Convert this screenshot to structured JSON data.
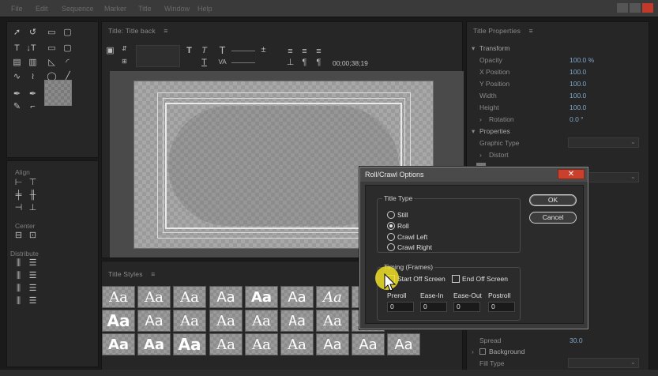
{
  "app": {
    "menu_items": [
      "File",
      "Edit",
      "Sequence",
      "Marker",
      "Title",
      "Window",
      "Help"
    ]
  },
  "tools_panel": {
    "tools": [
      "selection",
      "rotation",
      "text",
      "vertical-text",
      "area-text",
      "vertical-area-text",
      "path-text",
      "vertical-path-text",
      "pen",
      "delete-anchor",
      "add-anchor",
      "convert-anchor",
      "rectangle",
      "clipped-corner-rectangle",
      "rounded-corner-rectangle",
      "rounded-rectangle",
      "wedge",
      "arc",
      "ellipse",
      "line"
    ]
  },
  "actions_panel": {
    "align_label": "Align",
    "center_label": "Center",
    "distribute_label": "Distribute"
  },
  "title_panel": {
    "header": "Title: Title back",
    "timecode": "00;00;38;19"
  },
  "styles_panel": {
    "header": "Title Styles",
    "cell_text": "Aa"
  },
  "properties_panel": {
    "header": "Title Properties",
    "transform_label": "Transform",
    "rows": [
      {
        "key": "Opacity",
        "value": "100.0 %"
      },
      {
        "key": "X Position",
        "value": "100.0"
      },
      {
        "key": "Y Position",
        "value": "100.0"
      },
      {
        "key": "Width",
        "value": "100.0"
      },
      {
        "key": "Height",
        "value": "100.0"
      },
      {
        "key": "Rotation",
        "value": "0.0 °"
      }
    ],
    "properties_label": "Properties",
    "graphic_type_label": "Graphic Type",
    "distort_label": "Distort",
    "spread_label": "Spread",
    "spread_value": "30.0",
    "background_label": "Background",
    "fill_type_label": "Fill Type"
  },
  "dialog": {
    "title": "Roll/Crawl Options",
    "close_symbol": "✕",
    "title_type_label": "Title Type",
    "options": [
      "Still",
      "Roll",
      "Crawl Left",
      "Crawl Right"
    ],
    "selected_option": "Roll",
    "timing_label": "Timing (Frames)",
    "start_off_screen_label": "Start Off Screen",
    "end_off_screen_label": "End Off Screen",
    "fields": [
      {
        "label": "Preroll",
        "value": "0"
      },
      {
        "label": "Ease-In",
        "value": "0"
      },
      {
        "label": "Ease-Out",
        "value": "0"
      },
      {
        "label": "Postroll",
        "value": "0"
      }
    ],
    "ok_label": "OK",
    "cancel_label": "Cancel"
  }
}
